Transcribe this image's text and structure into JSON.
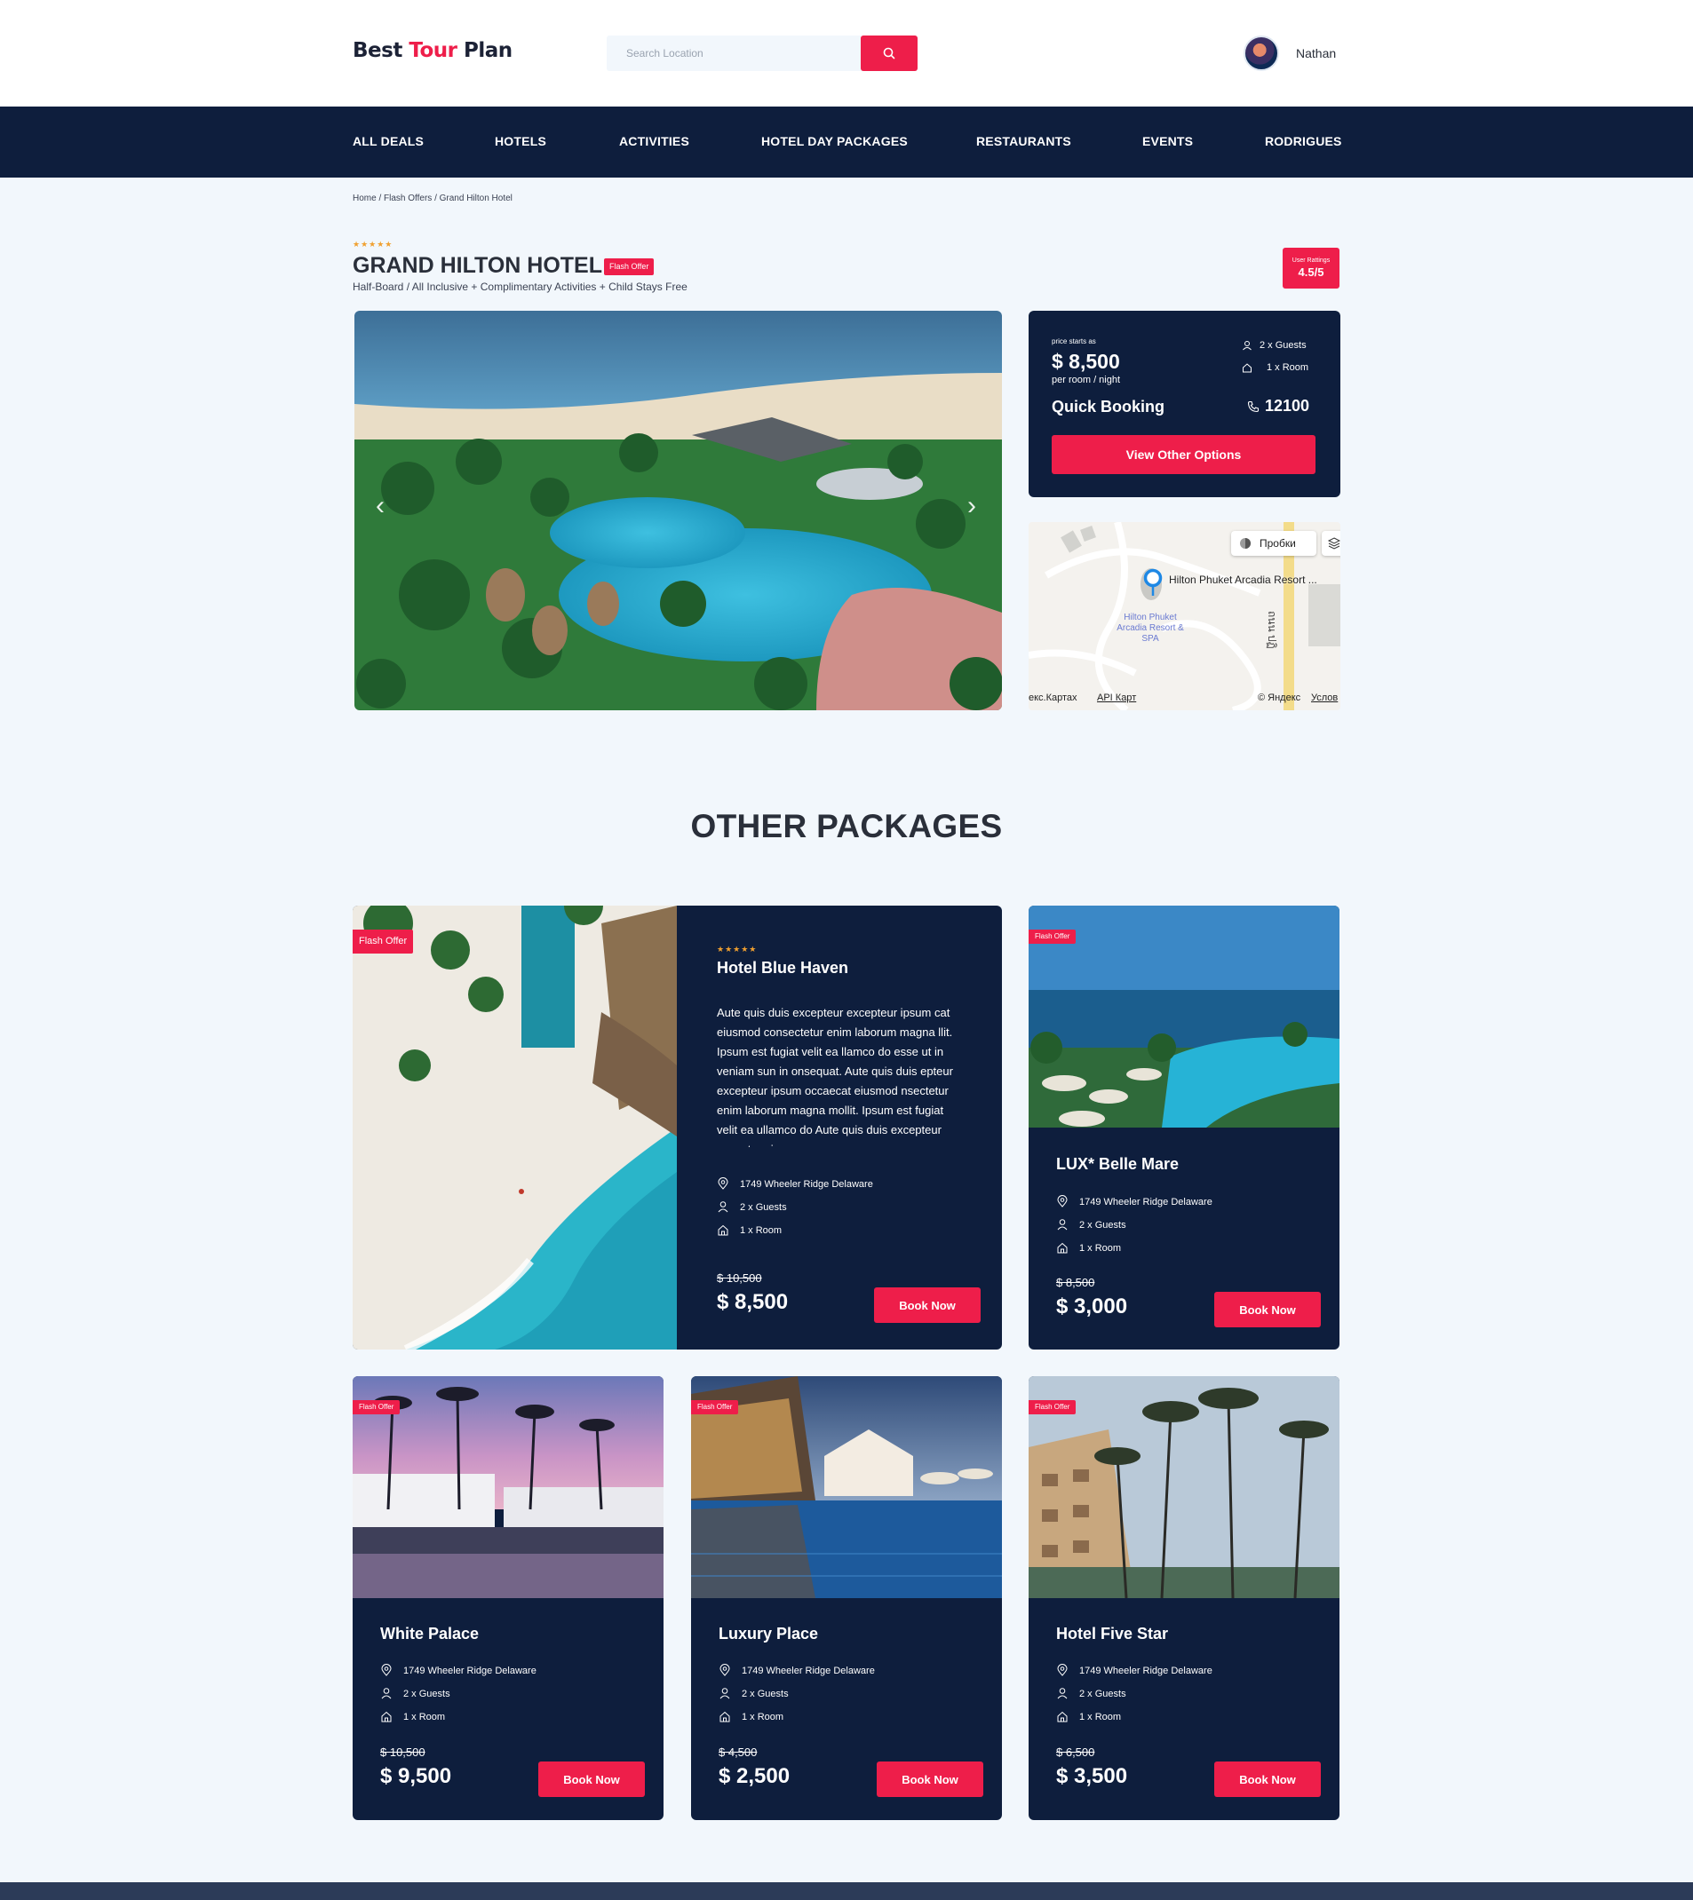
{
  "header": {
    "logo_part1": "Best ",
    "logo_part2": "Tour",
    "logo_part3": " Plan",
    "search_placeholder": "Search Location",
    "username": "Nathan"
  },
  "nav": [
    "ALL DEALS",
    "HOTELS",
    "ACTIVITIES",
    "HOTEL DAY PACKAGES",
    "RESTAURANTS",
    "EVENTS",
    "RODRIGUES"
  ],
  "breadcrumb": "Home / Flash Offers / Grand Hilton Hotel",
  "hotel": {
    "stars": "★★★★★",
    "title": "GRAND HILTON HOTEL",
    "badge": "Flash Offer",
    "subtitle": "Half-Board / All Inclusive + Complimentary Activities + Child Stays Free",
    "rating_label": "User Rattings",
    "rating_value": "4.5/5"
  },
  "booking": {
    "price_label": "price starts as",
    "price": "$ 8,500",
    "per_label": "per room / night",
    "guests": "2 x Guests",
    "rooms": "1 x Room",
    "quick": "Quick Booking",
    "phone": "12100",
    "button": "View Other Options"
  },
  "map": {
    "traffic": "Пробки",
    "poi": "Hilton Phuket Arcadia Resort ...",
    "poi_blue": "Hilton Phuket Arcadia Resort & SPA",
    "street": "ถนน ปฏิ",
    "foot_left": "екс.Картах",
    "foot_api": "API Карт",
    "foot_copy": "© Яндекс",
    "foot_terms": "Услов"
  },
  "section_title": "OTHER PACKAGES",
  "featured": {
    "badge": "Flash Offer",
    "stars": "★★★★★",
    "name": "Hotel Blue Haven",
    "desc": "Aute quis duis excepteur excepteur ipsum cat eiusmod consectetur enim laborum magna llit. Ipsum est fugiat velit ea llamco do esse ut in veniam sun in onsequat. Aute quis duis epteur excepteur ipsum occaecat eiusmod nsectetur enim laborum magna mollit. Ipsum est fugiat velit ea ullamco do Aute quis duis excepteur excepteur ipsum",
    "address": "1749 Wheeler Ridge Delaware",
    "guests": "2 x Guests",
    "rooms": "1 x Room",
    "old_price": "$ 10,500",
    "price": "$ 8,500",
    "button": "Book Now"
  },
  "packages": [
    {
      "badge": "Flash Offer",
      "name": "LUX* Belle Mare",
      "address": "1749 Wheeler Ridge Delaware",
      "guests": "2 x Guests",
      "rooms": "1 x Room",
      "old_price": "$ 8,500",
      "price": "$ 3,000",
      "button": "Book Now"
    },
    {
      "badge": "Flash Offer",
      "name": "White Palace",
      "address": "1749 Wheeler Ridge Delaware",
      "guests": "2 x Guests",
      "rooms": "1 x Room",
      "old_price": "$ 10,500",
      "price": "$ 9,500",
      "button": "Book Now"
    },
    {
      "badge": "Flash Offer",
      "name": "Luxury Place",
      "address": "1749 Wheeler Ridge Delaware",
      "guests": "2 x Guests",
      "rooms": "1 x Room",
      "old_price": "$ 4,500",
      "price": "$ 2,500",
      "button": "Book Now"
    },
    {
      "badge": "Flash Offer",
      "name": "Hotel Five Star",
      "address": "1749 Wheeler Ridge Delaware",
      "guests": "2 x Guests",
      "rooms": "1 x Room",
      "old_price": "$ 6,500",
      "price": "$ 3,500",
      "button": "Book Now"
    }
  ],
  "colors": {
    "navy": "#0e1e3d",
    "accent": "#ee1e4a",
    "background": "#f2f7fc",
    "star": "#f0a030"
  }
}
